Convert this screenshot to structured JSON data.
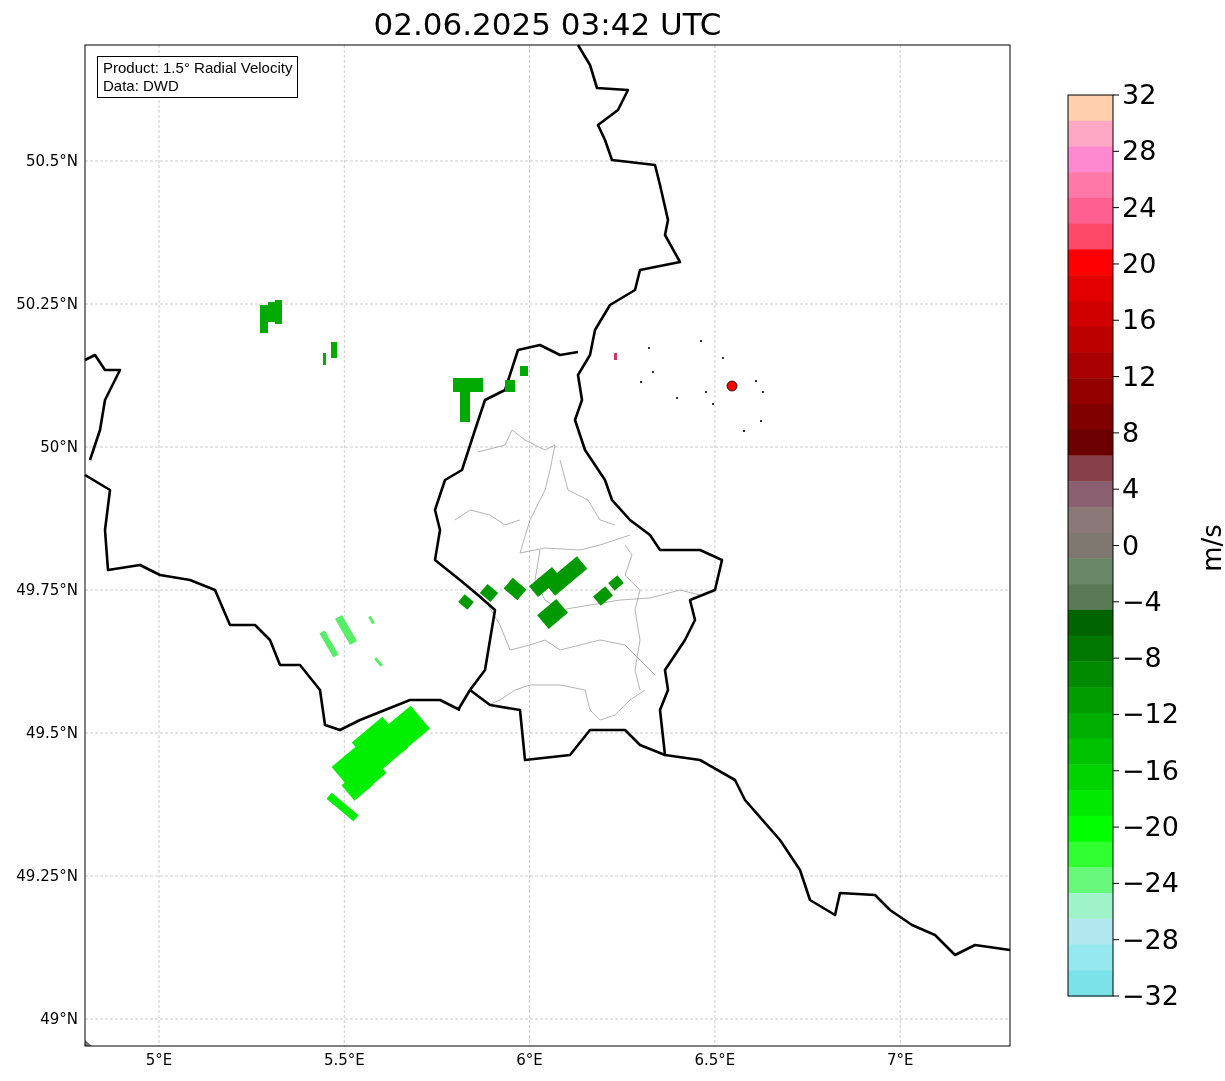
{
  "title": "02.06.2025 03:42 UTC",
  "info_box": [
    "Product: 1.5° Radial Velocity",
    "Data: DWD"
  ],
  "map": {
    "lat_ticks": [
      "50.5°N",
      "50.25°N",
      "50°N",
      "49.75°N",
      "49.5°N",
      "49.25°N",
      "49°N"
    ],
    "lon_ticks": [
      "5°E",
      "5.5°E",
      "6°E",
      "6.5°E",
      "7°E"
    ]
  },
  "colorbar": {
    "label": "m/s",
    "ticks": [
      "32",
      "28",
      "24",
      "20",
      "16",
      "12",
      "8",
      "4",
      "0",
      "−4",
      "−8",
      "−12",
      "−16",
      "−20",
      "−24",
      "−28",
      "−32"
    ],
    "bands": [
      {
        "color": "#ffcfae"
      },
      {
        "color": "#ffa8c6"
      },
      {
        "color": "#ff88d0"
      },
      {
        "color": "#ff78a8"
      },
      {
        "color": "#ff6090"
      },
      {
        "color": "#ff4868"
      },
      {
        "color": "#ff0000"
      },
      {
        "color": "#e40000"
      },
      {
        "color": "#d00000"
      },
      {
        "color": "#bc0000"
      },
      {
        "color": "#a80000"
      },
      {
        "color": "#940000"
      },
      {
        "color": "#800000"
      },
      {
        "color": "#6c0000"
      },
      {
        "color": "#884048"
      },
      {
        "color": "#8a6070"
      },
      {
        "color": "#8a7878"
      },
      {
        "color": "#7e7870"
      },
      {
        "color": "#6a8868"
      },
      {
        "color": "#5a7a55"
      },
      {
        "color": "#006400"
      },
      {
        "color": "#007800"
      },
      {
        "color": "#008a00"
      },
      {
        "color": "#009c00"
      },
      {
        "color": "#00b000"
      },
      {
        "color": "#00c200"
      },
      {
        "color": "#00d400"
      },
      {
        "color": "#00ea00"
      },
      {
        "color": "#00ff00"
      },
      {
        "color": "#30ff30"
      },
      {
        "color": "#66f87a"
      },
      {
        "color": "#a0f2c8"
      },
      {
        "color": "#b0e8ee"
      },
      {
        "color": "#94e8ee"
      },
      {
        "color": "#7ae2e8"
      }
    ]
  }
}
